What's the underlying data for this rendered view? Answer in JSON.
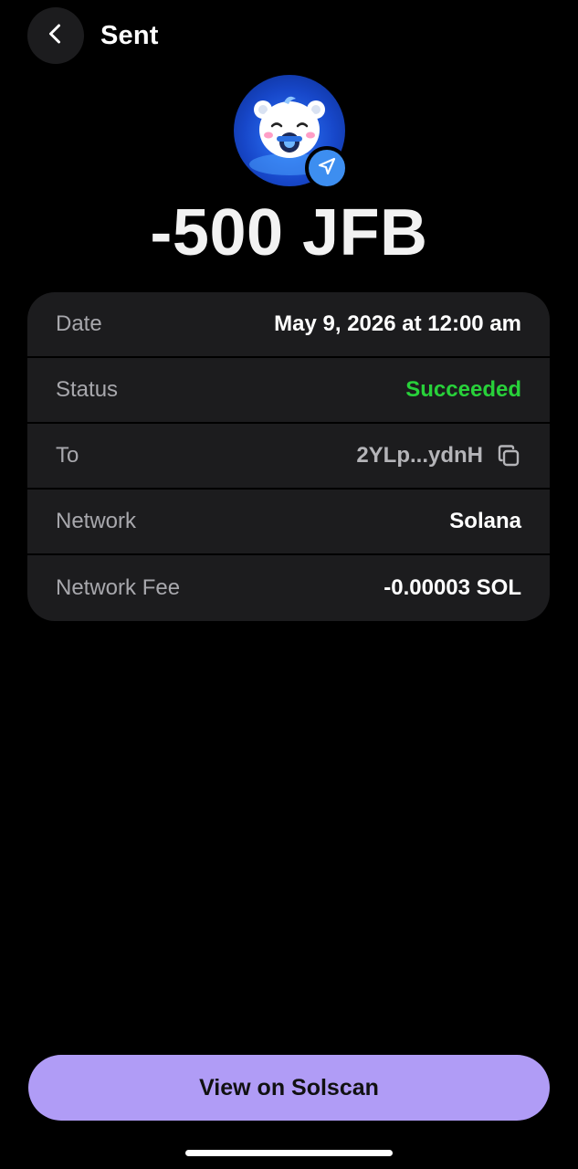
{
  "header": {
    "title": "Sent"
  },
  "icons": {
    "back": "chevron-left-icon",
    "badge": "send-arrow-icon",
    "copy": "copy-icon"
  },
  "token": {
    "avatar": "baby-mascot-token-logo",
    "amount": "-500 JFB"
  },
  "details": {
    "rows": [
      {
        "label": "Date",
        "value": "May 9, 2026 at 12:00 am"
      },
      {
        "label": "Status",
        "value": "Succeeded"
      },
      {
        "label": "To",
        "value": "2YLp...ydnH"
      },
      {
        "label": "Network",
        "value": "Solana"
      },
      {
        "label": "Network Fee",
        "value": "-0.00003 SOL"
      }
    ]
  },
  "actions": {
    "view_solscan": "View on Solscan"
  },
  "colors": {
    "background": "#000000",
    "card": "#1c1c1e",
    "success": "#28d13a",
    "button": "#b09cf6",
    "badge": "#3d8ef0"
  }
}
